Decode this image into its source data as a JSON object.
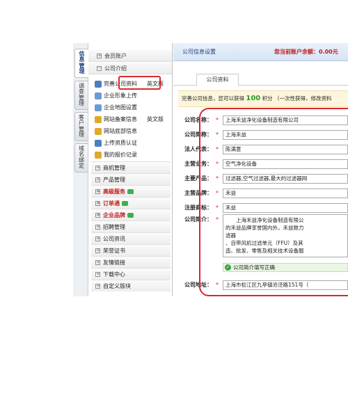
{
  "vertical_tabs": [
    "信息管理",
    "调查管理",
    "客户管理",
    "域名绑定"
  ],
  "menu": {
    "top_items": [
      "会员账户",
      "公司介绍"
    ],
    "sub_items": [
      {
        "label": "完善公司资料",
        "extra": "英文版",
        "icon_color": "#4a7fc1"
      },
      {
        "label": "企业形象上传",
        "extra": "",
        "icon_color": "#6b9bd6"
      },
      {
        "label": "企业地图设置",
        "extra": "",
        "icon_color": "#6b9bd6"
      },
      {
        "label": "网站备案信息",
        "extra": "英文版",
        "icon_color": "#e0a82a"
      },
      {
        "label": "网站底部信息",
        "extra": "",
        "icon_color": "#e0a82a"
      },
      {
        "label": "上传资质认证",
        "extra": "",
        "icon_color": "#4a7fc1"
      },
      {
        "label": "我的报价记录",
        "extra": "",
        "icon_color": "#e0a82a"
      }
    ],
    "sections": [
      {
        "label": "商机管理",
        "red": false,
        "bubble": false
      },
      {
        "label": "产品管理",
        "red": false,
        "bubble": false
      },
      {
        "label": "高级服务",
        "red": true,
        "bubble": true
      },
      {
        "label": "订单通",
        "red": true,
        "bubble": true
      },
      {
        "label": "企业品牌",
        "red": true,
        "bubble": true
      },
      {
        "label": "招聘管理",
        "red": false,
        "bubble": false
      },
      {
        "label": "公司资讯",
        "red": false,
        "bubble": false
      },
      {
        "label": "荣誉证书",
        "red": false,
        "bubble": false
      },
      {
        "label": "友情链接",
        "red": false,
        "bubble": false
      },
      {
        "label": "下载中心",
        "red": false,
        "bubble": false
      },
      {
        "label": "自定义版块",
        "red": false,
        "bubble": false
      }
    ]
  },
  "header": {
    "title": "公司信息设置",
    "balance": "您当前账户余额：0.00元"
  },
  "tab": {
    "label": "公司资料"
  },
  "notice": {
    "prefix": "完善公司信息，您可以获得",
    "points": "100",
    "suffix": "积分 （一次性获得，修改资料"
  },
  "form": {
    "fields": [
      {
        "label": "公司名称：",
        "value": "上海禾益净化设备制造有限公司"
      },
      {
        "label": "公司简称：",
        "value": "上海禾益"
      },
      {
        "label": "法人代表：",
        "value": "陈满意"
      },
      {
        "label": "主营业务：",
        "value": "空气净化设备"
      },
      {
        "label": "主要产品：",
        "value": "过滤器,空气过滤器,最大的过滤器网"
      },
      {
        "label": "主营品牌：",
        "value": "禾益"
      },
      {
        "label": "注册商标：",
        "value": "禾益"
      }
    ],
    "intro_label": "公司简介：",
    "intro_lines": [
      "　　上海禾益净化设备制造有限公",
      "的禾益品牌享誉国内外。禾益致力",
      "滤器",
      "、自带风机过滤单元（FFU）及其",
      "造、批发、零售及相关技术设备服"
    ],
    "intro_ok": "公司简介填写正确",
    "address_label": "公司地址：",
    "address_value": "上海市松江区九亭镇沧泾路151号（"
  },
  "star": "*"
}
